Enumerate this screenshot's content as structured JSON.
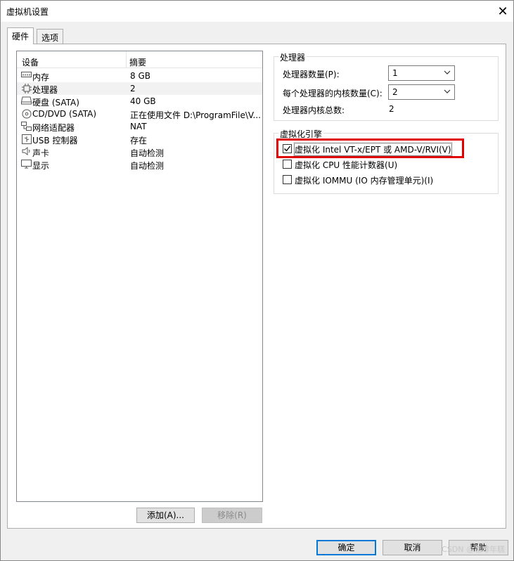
{
  "window": {
    "title": "虚拟机设置",
    "close_glyph": "✕"
  },
  "tabs": [
    {
      "label": "硬件",
      "active": true
    },
    {
      "label": "选项",
      "active": false
    }
  ],
  "device_list": {
    "headers": {
      "device": "设备",
      "summary": "摘要"
    },
    "rows": [
      {
        "icon": "memory-icon",
        "name": "内存",
        "summary": "8 GB"
      },
      {
        "icon": "processor-icon",
        "name": "处理器",
        "summary": "2",
        "selected": true
      },
      {
        "icon": "harddisk-icon",
        "name": "硬盘 (SATA)",
        "summary": "40 GB"
      },
      {
        "icon": "cd-dvd-icon",
        "name": "CD/DVD (SATA)",
        "summary": "正在使用文件 D:\\ProgramFile\\V..."
      },
      {
        "icon": "network-adapter-icon",
        "name": "网络适配器",
        "summary": "NAT"
      },
      {
        "icon": "usb-controller-icon",
        "name": "USB 控制器",
        "summary": "存在"
      },
      {
        "icon": "sound-card-icon",
        "name": "声卡",
        "summary": "自动检测"
      },
      {
        "icon": "display-icon",
        "name": "显示",
        "summary": "自动检测"
      }
    ]
  },
  "processor_group": {
    "title": "处理器",
    "count_label": "处理器数量(P):",
    "count_value": "1",
    "cores_label": "每个处理器的内核数量(C):",
    "cores_value": "2",
    "total_label": "处理器内核总数:",
    "total_value": "2"
  },
  "virtualization_group": {
    "title": "虚拟化引擎",
    "options": [
      {
        "label": "虚拟化 Intel VT-x/EPT 或 AMD-V/RVI(V)",
        "checked": true
      },
      {
        "label": "虚拟化 CPU 性能计数器(U)",
        "checked": false
      },
      {
        "label": "虚拟化 IOMMU (IO 内存管理单元)(I)",
        "checked": false
      }
    ]
  },
  "buttons": {
    "add": "添加(A)...",
    "remove": "移除(R)",
    "ok": "确定",
    "cancel": "取消",
    "help": "帮助"
  },
  "watermark": "CSDN @咖啡年糕",
  "colors": {
    "highlight_border": "#e00000",
    "default_button_border": "#0078d7",
    "selected_row": "#f2f2f2"
  }
}
